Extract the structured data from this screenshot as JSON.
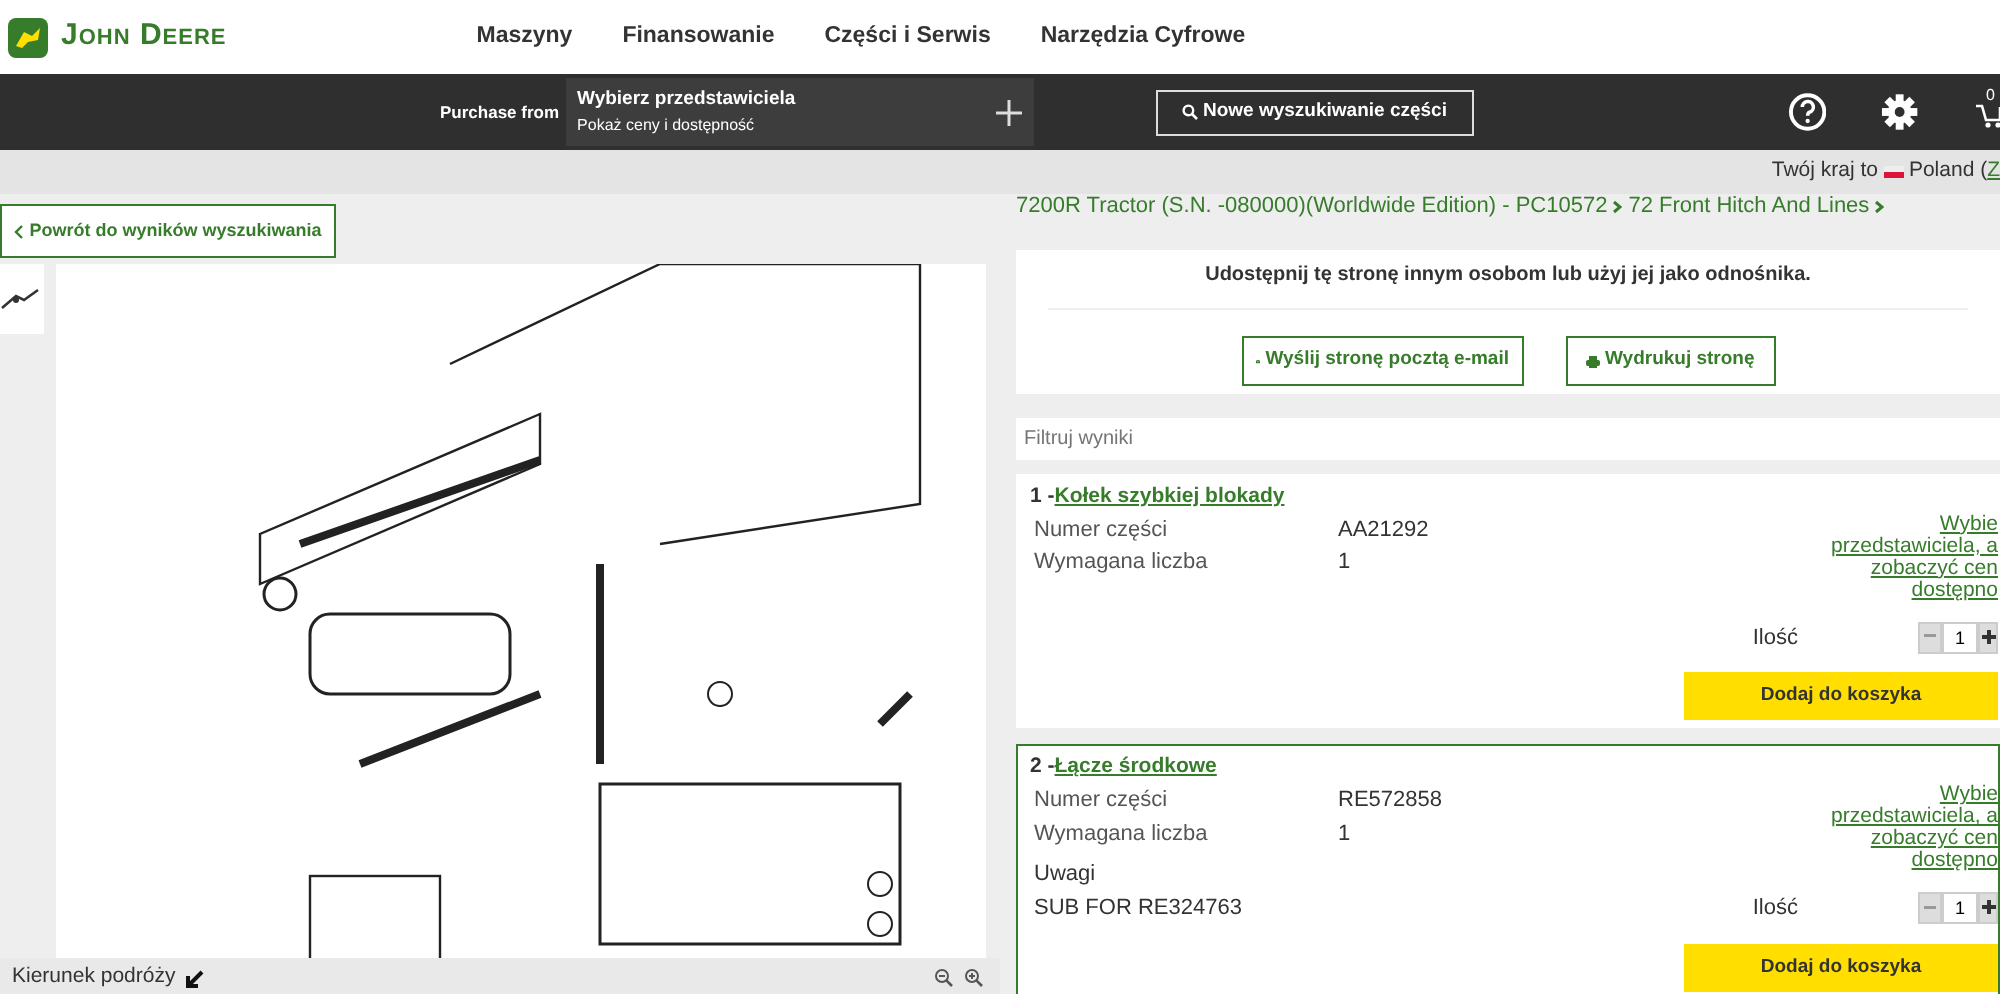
{
  "header": {
    "brand": "John Deere",
    "nav": [
      "Maszyny",
      "Finansowanie",
      "Części i Serwis",
      "Narzędzia Cyfrowe"
    ]
  },
  "dealer_bar": {
    "label": "Purchase from",
    "dealer_title": "Wybierz przedstawiciela",
    "dealer_subtitle": "Pokaż ceny i dostępność",
    "search_button": "Nowe wyszukiwanie części",
    "cart_count": "0"
  },
  "country_bar": {
    "text": "Twój kraj to",
    "country": "Poland (",
    "change_link": "Z"
  },
  "back_button": "Powrót do wyników wyszukiwania",
  "breadcrumb": [
    "7200R Tractor (S.N. -080000)(Worldwide Edition) - PC10572",
    "72 Front Hitch And Lines"
  ],
  "diagram_footer": {
    "label": "Kierunek podróży"
  },
  "share": {
    "text": "Udostępnij tę stronę innym osobom lub użyj jej jako odnośnika.",
    "email_button": "Wyślij stronę pocztą e-mail",
    "print_button": "Wydrukuj stronę"
  },
  "filter": {
    "placeholder": "Filtruj wyniki"
  },
  "parts": [
    {
      "number": "1 -",
      "name": "Kołek szybkiej blokady",
      "selected": false,
      "fields": [
        {
          "label": "Numer części",
          "value": "AA21292"
        },
        {
          "label": "Wymagana liczba",
          "value": "1"
        }
      ],
      "dealer_link": "Wybie\nprzedstawiciela, a\nzobaczyć cen\ndostępno",
      "qty_label": "Ilość",
      "qty": "1",
      "add_button": "Dodaj do koszyka"
    },
    {
      "number": "2 -",
      "name": "Łącze środkowe",
      "selected": true,
      "fields": [
        {
          "label": "Numer części",
          "value": "RE572858"
        },
        {
          "label": "Wymagana liczba",
          "value": "1"
        }
      ],
      "notes": [
        "Uwagi",
        "SUB FOR RE324763"
      ],
      "dealer_link": "Wybie\nprzedstawiciela, a\nzobaczyć cen\ndostępno",
      "qty_label": "Ilość",
      "qty": "1",
      "add_button": "Dodaj do koszyka"
    }
  ]
}
